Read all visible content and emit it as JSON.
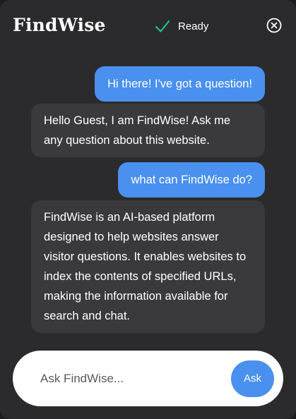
{
  "header": {
    "brand": "FindWise",
    "status_label": "Ready",
    "status_icon": "check-icon",
    "close_icon": "close-circle-icon"
  },
  "messages": [
    {
      "role": "user",
      "text": "Hi there! I've got a question!"
    },
    {
      "role": "bot",
      "text": "Hello Guest, I am FindWise! Ask me any question about this website."
    },
    {
      "role": "user",
      "text": "what can FindWise do?"
    },
    {
      "role": "bot",
      "text": "FindWise is an AI-based platform designed to help websites answer visitor questions. It enables websites to index the contents of specified URLs, making the information available for search and chat."
    }
  ],
  "composer": {
    "value": "",
    "placeholder": "Ask FindWise...",
    "ask_label": "Ask"
  },
  "colors": {
    "panel_bg": "#2b2b2d",
    "user_bubble": "#4a90ee",
    "bot_bubble": "#3a3a3c",
    "status_check": "#22c08a"
  }
}
